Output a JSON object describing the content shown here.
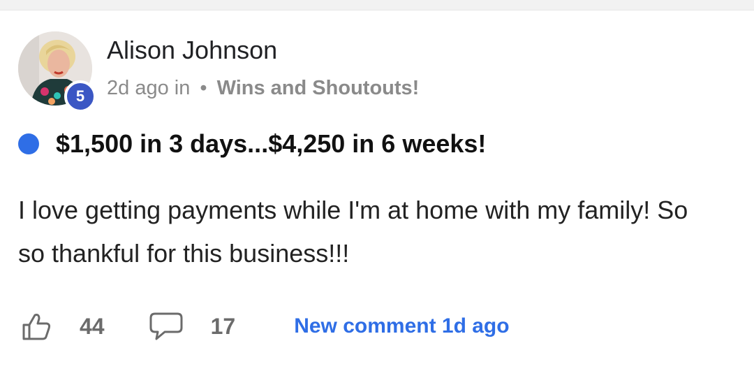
{
  "post": {
    "author": "Alison Johnson",
    "level": "5",
    "time": "2d ago in",
    "separator": "•",
    "category": "Wins and Shoutouts!",
    "title": "$1,500 in 3 days...$4,250 in 6 weeks!",
    "body": "I love getting payments while I'm at home with my family! So so thankful for this business!!!"
  },
  "actions": {
    "likes": "44",
    "comments": "17",
    "new_comment": "New comment 1d ago"
  },
  "icons": {
    "like": "thumbs-up-icon",
    "comment": "comment-bubble-icon"
  },
  "colors": {
    "accent": "#2f6ee6",
    "badge": "#3b57c4",
    "meta": "#8a8a8a"
  }
}
